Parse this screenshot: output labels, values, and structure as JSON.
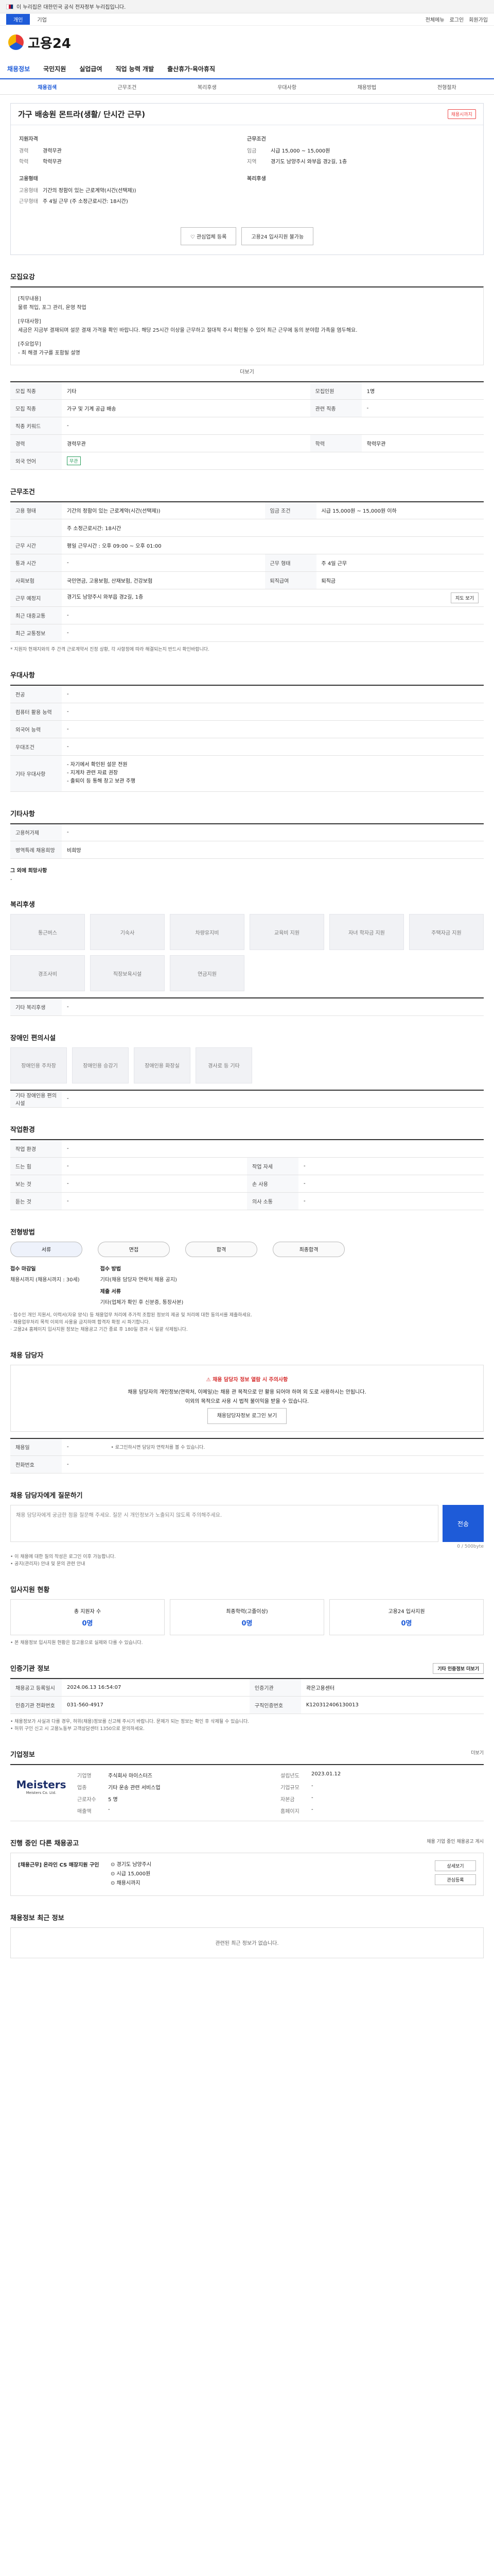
{
  "gov_bar": {
    "text": "이 누리집은 대한민국 공식 전자정부 누리집입니다.",
    "toggle": ""
  },
  "util": {
    "tabs": [
      "개인",
      "기업"
    ],
    "right": [
      "전체메뉴",
      "로그인",
      "회원가입"
    ]
  },
  "logo": {
    "text": "고용24"
  },
  "nav": [
    "채용정보",
    "국민지원",
    "실업급여",
    "직업 능력 개발",
    "출산휴가·육아휴직"
  ],
  "subnav": [
    "채용검색",
    "근무조건",
    "복리후생",
    "우대사항",
    "채용방법",
    "전형절차"
  ],
  "job": {
    "title": "가구 배송원 몬트라(생활/ 단시간 근무)",
    "badge": "채용시까지",
    "summary_left_title": "지원자격",
    "summary_left": [
      [
        "경력",
        "경력무관"
      ],
      [
        "학력",
        "학력무관"
      ]
    ],
    "summary_right_title": "근무조건",
    "summary_right": [
      [
        "임금",
        "시급 15,000 ~ 15,000원"
      ],
      [
        "지역",
        "경기도 남양주시 와부읍 경2길, 1층"
      ]
    ],
    "summary_bottom_left_title": "고용형태",
    "summary_bottom_left": [
      [
        "고용형태",
        "기간의 정함이 있는 근로계약(시간(선택제))"
      ],
      [
        "근무형태",
        "주 4일 근무 (주 소정근로시간: 18시간)"
      ]
    ],
    "summary_bottom_right_title": "복리후생",
    "actions": [
      "관심업체 등록",
      "고용24 입사지원 불가능"
    ]
  },
  "sec_recruit": {
    "title": "모집요강",
    "content": [
      "[직무내용]",
      "물류 적입, 포그 관리, 운영 작업",
      "",
      "[우대사항]",
      "세금은 지금부 결재되며 설문 결재 가격을 확인 바랍니다. 해당 25시간 이상을 근무하고 절대적 주시 확인될 수 있어 최근 근무에 동의 분야합 가족을 염두해요.",
      "",
      "[주요업무]",
      "- 최 해결 가구를 포함될 설명"
    ],
    "more": "더보기",
    "rows": [
      [
        [
          "모집 직종",
          "기타"
        ],
        [
          "모집인원",
          "1명"
        ]
      ],
      [
        [
          "모집 직종",
          "가구 및 기계 공급 배송"
        ],
        [
          "관련 직종",
          "-"
        ]
      ],
      [
        [
          "직종 키워드",
          "-"
        ],
        [
          "",
          ""
        ]
      ],
      [
        [
          "경력",
          "경력무관"
        ],
        [
          "학력",
          "학력무관"
        ]
      ],
      [
        [
          "외국 언어",
          "무관"
        ],
        [
          "",
          ""
        ]
      ]
    ]
  },
  "sec_condition": {
    "title": "근무조건",
    "rows": [
      [
        "고용 형태",
        "기간의 정함이 있는 근로계약(시간(선택제))"
      ],
      [
        "",
        "주 소정근로시간: 18시간"
      ],
      [
        "근무 시간",
        "평일 근무시간 : 오후 09:00 ~ 오후 01:00"
      ],
      [
        "통과 시간",
        "-"
      ],
      [
        "사회보험",
        "국민연금, 고용보험, 산재보험, 건강보험"
      ],
      [
        "근무 예정지",
        "경기도 남양주시 와부읍 경2길, 1층"
      ],
      [
        "최근 대중교통",
        "-"
      ],
      [
        "최근 교통정보",
        "-"
      ]
    ],
    "wage": "시급 15,000원 ~ 15,000원 이하",
    "wage_label": "임금 조건",
    "workdays_label": "근무 형태",
    "workdays": "주 4일 근무",
    "retire_label": "퇴직급여",
    "retire": "퇴직금",
    "map_btn": "지도 보기",
    "note": "* 지원자 현재지와의 주 간격 근로계약서 진정 상황, 각 사항정에 따라 해결되는지 반드시 확인바랍니다."
  },
  "sec_pref": {
    "title": "우대사항",
    "rows": [
      [
        "전공",
        "-"
      ],
      [
        "컴퓨터 활용 능력",
        "-"
      ],
      [
        "외국어 능력",
        "-"
      ],
      [
        "우대조건",
        "-"
      ],
      [
        "기타 우대사항",
        "- 자기에서 확인된 설문 전원"
      ]
    ],
    "extra": [
      "- 지게차 관련 자료 권장",
      "- 출퇴이 등 통해 창고 보관 주행"
    ]
  },
  "sec_other": {
    "title": "기타사항",
    "rows": [
      [
        "고용허가제",
        "-"
      ],
      [
        "병역특례 채용희망",
        "비희망"
      ]
    ],
    "sub": "그 외에 희망사항",
    "sub_val": "-"
  },
  "sec_welfare": {
    "title": "복리후생",
    "items": [
      "통근버스",
      "기숙사",
      "차량유지비",
      "교육비 지원",
      "자녀 학자금 지원",
      "주택자금 지원",
      "경조사비",
      "직장보육시설",
      "연금지원"
    ],
    "other_label": "기타 복리후생",
    "other_val": "-"
  },
  "sec_disab": {
    "title": "장애인 편의시설",
    "items": [
      "장애인용 주차장",
      "장애인용 승강기",
      "장애인용 화장실",
      "경사로 등 기타"
    ],
    "other_label": "기타 장애인용 편의시설",
    "other_val": "-"
  },
  "sec_workenv": {
    "title": "작업환경",
    "rows": [
      [
        "작업 환경",
        "-"
      ],
      [
        "드는 힘",
        "-"
      ],
      [
        "보는 것",
        "-"
      ],
      [
        "듣는 것",
        "-"
      ]
    ],
    "rows_r": [
      [
        "",
        ""
      ],
      [
        "작업 자세",
        "-"
      ],
      [
        "손 사용",
        "-"
      ],
      [
        "의사 소통",
        "-"
      ]
    ]
  },
  "sec_process": {
    "title": "전형방법",
    "steps": [
      "서류",
      "면접",
      "합격",
      "최종합격"
    ],
    "apply_title": "접수 마감일",
    "apply_val": "채용시까지 (채용시까지 : 30세)",
    "method_title": "접수 방법",
    "method_val": "기타(채용 담당자 연락처 채용 공지)",
    "docs_title": "제출 서류",
    "docs_val": "기타(업체가 확인 후 신분증, 통장사본)",
    "notes": [
      "· 접수인 개인 지원서, 이력서(자유 양식) 등 채용업무 처리에 추가적 조합된 정보의 제공 및 처리에 대한 동의서를 제출하세요.",
      "· 채용업무처리 목적 이외의 사용을 금지하며 합격자 확정 시 파기합니다.",
      "· 고용24 홈페이지 입사지원 정보는 채용공고 기간 종료 후 180일 경과 시 일괄 삭제됩니다."
    ]
  },
  "sec_contact": {
    "title": "채용 담당자",
    "warn_title": "채용 담당자 정보 열람 시 주의사항",
    "warn_lines": [
      "채용 담당자의 개인정보(연락처, 이메일)는 채용 관 목적으로 만 활용 되어야 하며 외 도로 사용하시는 안됩니다.",
      "이외의 목적으로 사용 시 법적 불이익을 받을 수 있습니다."
    ],
    "btn": "채용담당자정보 로그인 보기",
    "rows": [
      [
        "채용일",
        "-"
      ],
      [
        "전화번호",
        "-"
      ]
    ],
    "tip": "• 로그인하시면 담당자 연락처를 볼 수 있습니다."
  },
  "sec_qa": {
    "title": "채용 담당자에게 질문하기",
    "placeholder": "채용 담당자에게 궁금한 점을 질문해 주세요. 질문 시 개인정보가 노출되지 않도록 주의해주세요.",
    "send": "전송",
    "counter": "0 / 500byte",
    "notes": [
      "• 이 채용에 대한 질의 작성은 로그인 이후 가능합니다.",
      "• 공지(관리자) 안내 및 문의 관련 안내"
    ]
  },
  "sec_stats": {
    "title": "입사지원 현황",
    "items": [
      [
        "총 지원자 수",
        "0명"
      ],
      [
        "최종학력(고졸이상)",
        "0명"
      ],
      [
        "고용24 입사지원",
        "0명"
      ]
    ],
    "note": "• 본 채용정보 입사지원 현황은 참고용으로 실제와 다를 수 있습니다."
  },
  "sec_info": {
    "title": "인증기관 정보",
    "btn": "기타 인증정보 더보기",
    "rows": [
      [
        [
          "채용공고 등록일시",
          "2024.06.13 16:54:07"
        ],
        [
          "인증기관",
          "곽은고용센터"
        ]
      ],
      [
        [
          "인증기관 전화번호",
          "031-560-4917"
        ],
        [
          "구직인증번호",
          "K120312406130013"
        ]
      ]
    ],
    "notes": [
      "• 채용정보가 사실과 다를 경우, 허위(채용)정보를 신고해 주시기 바랍니다. 문제가 되는 정보는 확인 후 삭제될 수 있습니다.",
      "• 허위 구인 신고 시 고용노동부 고객상담센터 1350으로 문의하세요."
    ]
  },
  "sec_company": {
    "title": "기업정보",
    "more": "더보기",
    "logo_main": "Meisters",
    "logo_sub": "Meisters Co. Ltd.",
    "info": [
      [
        "기업명",
        "주식회사 마이스터즈"
      ],
      [
        "설립년도",
        "2023.01.12"
      ],
      [
        "업종",
        "기타 운송 관련 서비스업"
      ],
      [
        "기업규모",
        "-"
      ],
      [
        "근로자수",
        "5 명"
      ],
      [
        "자본금",
        "-"
      ],
      [
        "매출액",
        "-"
      ],
      [
        "홈페이지",
        "-"
      ]
    ]
  },
  "sec_others": {
    "title": "진행 중인 다른 채용공고",
    "note": "채용 기업 중인 채용공고 게시",
    "job_title": "[채용근무] 온라인 CS 매장지원 구인",
    "job_lines": [
      "⊙ 경기도 남양주시",
      "⊙ 시급 15,000원",
      "⊙ 채용시까지"
    ],
    "tags": [
      "상세보기",
      "관심등록"
    ]
  },
  "sec_recent": {
    "title": "채용정보 최근 정보",
    "empty": "관련된 최근 정보가 없습니다."
  }
}
